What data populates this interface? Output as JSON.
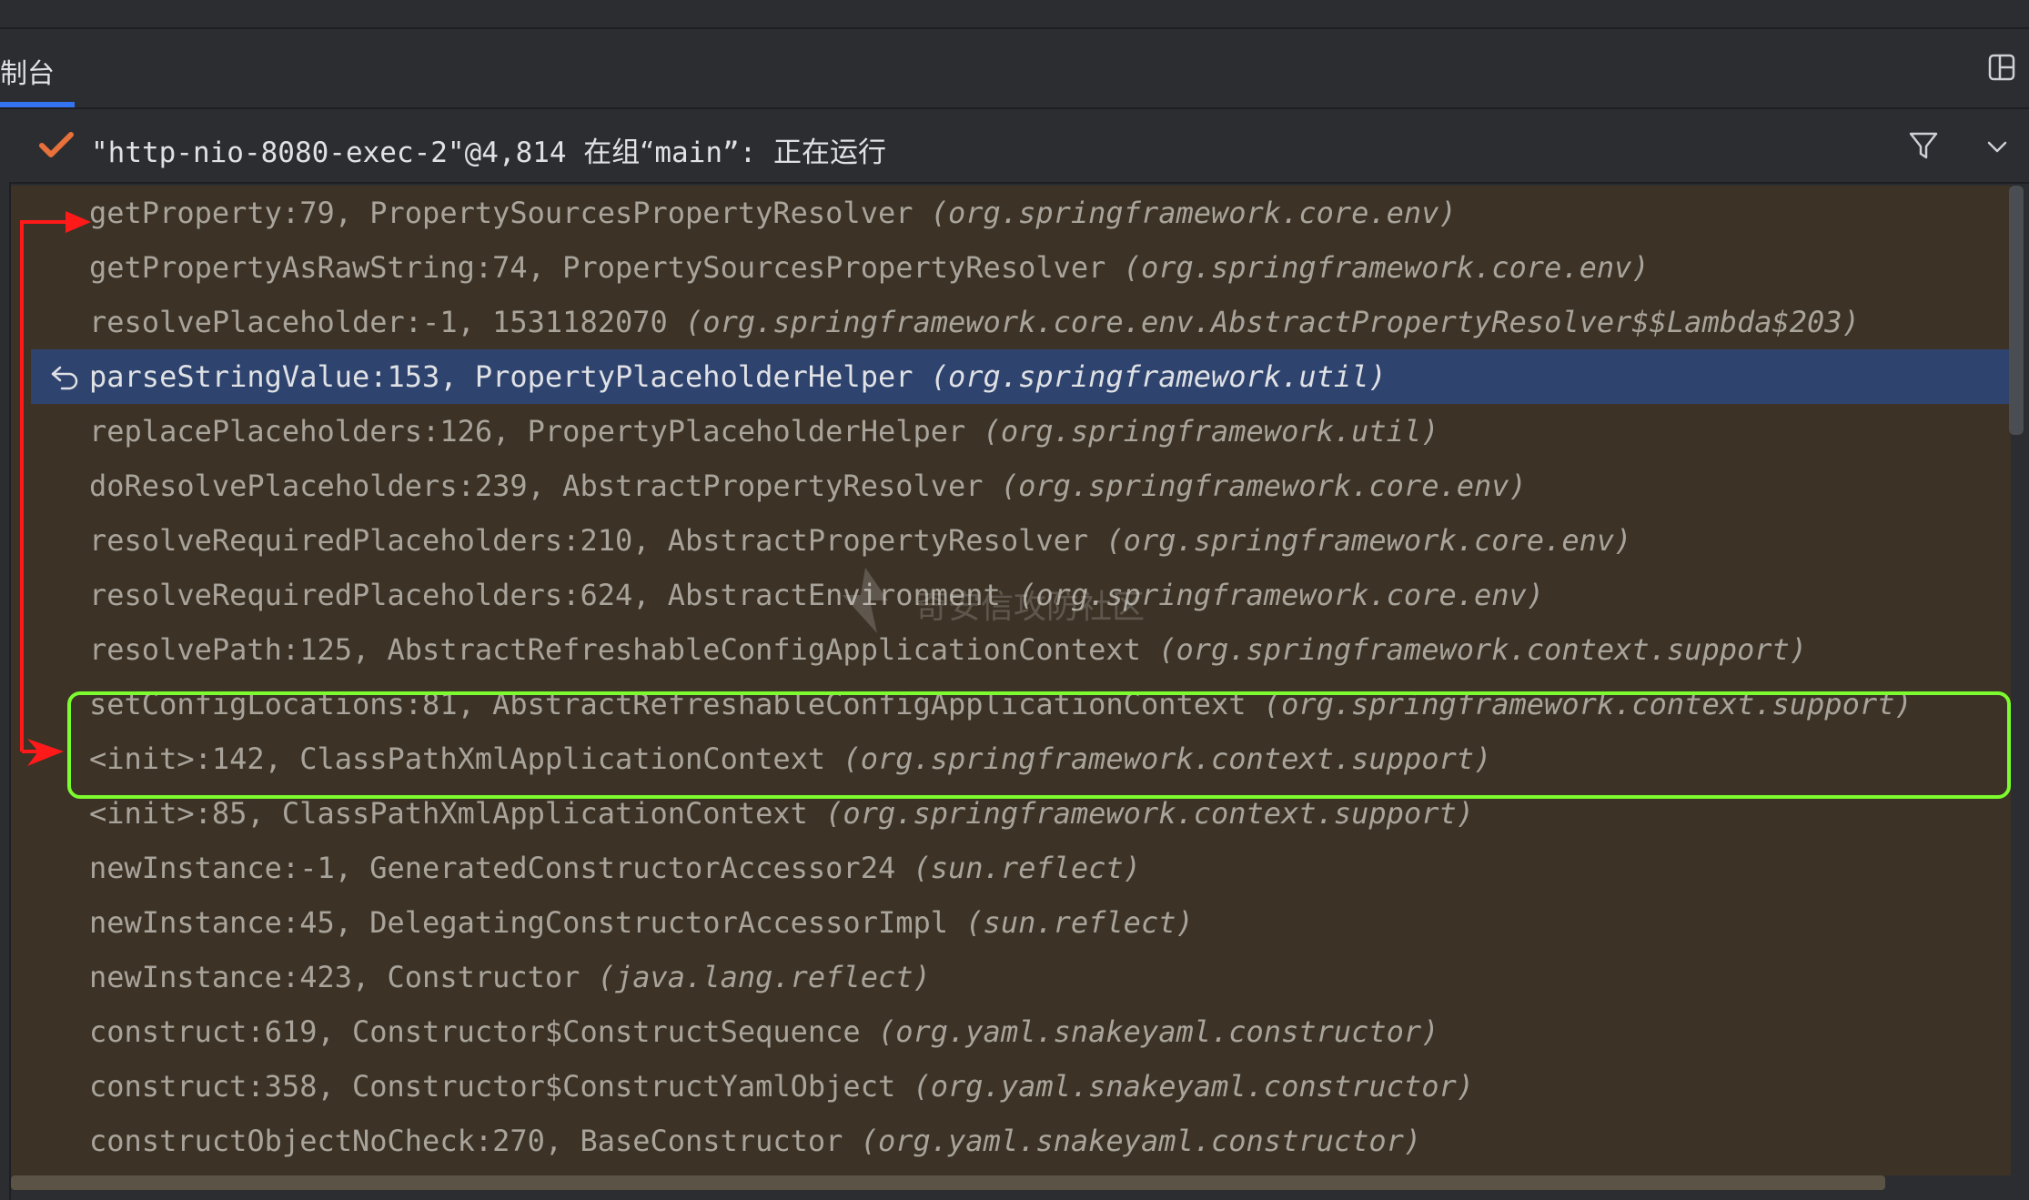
{
  "panel": {
    "tab_label": "制台",
    "layout_icon": "layout-toggle-icon"
  },
  "thread": {
    "status_icon": "check-icon",
    "name": "\"http-nio-8080-exec-2\"@4,814",
    "group_prefix": "在组“",
    "group_name": "main",
    "group_suffix": "”:",
    "status": "正在运行",
    "filter_icon": "filter-icon",
    "expand_icon": "chevron-down-icon"
  },
  "frames": [
    {
      "method": "getProperty:79, ",
      "cls": "PropertySourcesPropertyResolver ",
      "pkg": "(org.springframework.core.env)"
    },
    {
      "method": "getPropertyAsRawString:74, ",
      "cls": "PropertySourcesPropertyResolver ",
      "pkg": "(org.springframework.core.env)"
    },
    {
      "method": "resolvePlaceholder:-1, ",
      "cls": "1531182070 ",
      "pkg": "(org.springframework.core.env.AbstractPropertyResolver$$Lambda$203)"
    },
    {
      "method": "parseStringValue:153, ",
      "cls": "PropertyPlaceholderHelper ",
      "pkg": "(org.springframework.util)",
      "selected": true
    },
    {
      "method": "replacePlaceholders:126, ",
      "cls": "PropertyPlaceholderHelper ",
      "pkg": "(org.springframework.util)"
    },
    {
      "method": "doResolvePlaceholders:239, ",
      "cls": "AbstractPropertyResolver ",
      "pkg": "(org.springframework.core.env)"
    },
    {
      "method": "resolveRequiredPlaceholders:210, ",
      "cls": "AbstractPropertyResolver ",
      "pkg": "(org.springframework.core.env)"
    },
    {
      "method": "resolveRequiredPlaceholders:624, ",
      "cls": "AbstractEnvironment ",
      "pkg": "(org.springframework.core.env)"
    },
    {
      "method": "resolvePath:125, ",
      "cls": "AbstractRefreshableConfigApplicationContext ",
      "pkg": "(org.springframework.context.support)"
    },
    {
      "method": "setConfigLocations:81, ",
      "cls": "AbstractRefreshableConfigApplicationContext ",
      "pkg": "(org.springframework.context.support)"
    },
    {
      "method": "<init>:142, ",
      "cls": "ClassPathXmlApplicationContext ",
      "pkg": "(org.springframework.context.support)"
    },
    {
      "method": "<init>:85, ",
      "cls": "ClassPathXmlApplicationContext ",
      "pkg": "(org.springframework.context.support)"
    },
    {
      "method": "newInstance:-1, ",
      "cls": "GeneratedConstructorAccessor24 ",
      "pkg": "(sun.reflect)"
    },
    {
      "method": "newInstance:45, ",
      "cls": "DelegatingConstructorAccessorImpl ",
      "pkg": "(sun.reflect)"
    },
    {
      "method": "newInstance:423, ",
      "cls": "Constructor ",
      "pkg": "(java.lang.reflect)"
    },
    {
      "method": "construct:619, ",
      "cls": "Constructor$ConstructSequence ",
      "pkg": "(org.yaml.snakeyaml.constructor)"
    },
    {
      "method": "construct:358, ",
      "cls": "Constructor$ConstructYamlObject ",
      "pkg": "(org.yaml.snakeyaml.constructor)"
    },
    {
      "method": "constructObjectNoCheck:270, ",
      "cls": "BaseConstructor ",
      "pkg": "(org.yaml.snakeyaml.constructor)"
    }
  ],
  "selected_frame_icon": "return-arrow-icon",
  "watermark": {
    "text": "奇安信攻防社区"
  },
  "colors": {
    "accent": "#3574f0",
    "check": "#e8703a",
    "selection": "#2e436e",
    "stack_bg": "#3c3226",
    "annotation_arrow": "#ff1a1a",
    "annotation_box": "#7cfc2f"
  }
}
